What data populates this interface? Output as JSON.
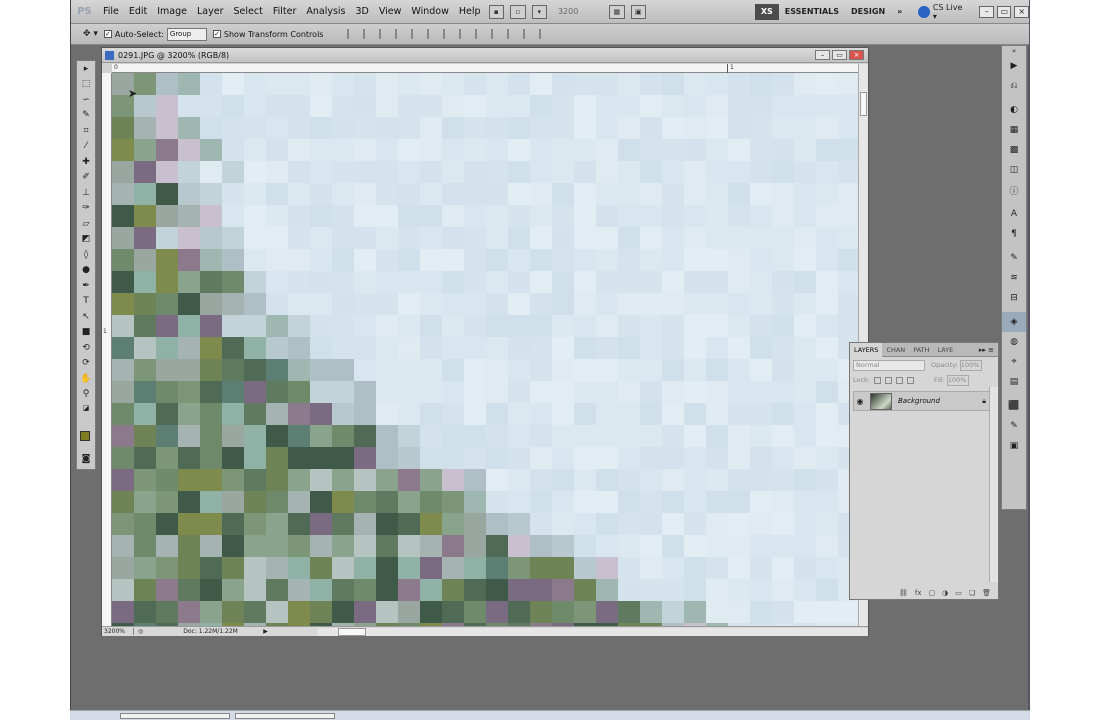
{
  "menubar": {
    "logo": "PS",
    "items": [
      "File",
      "Edit",
      "Image",
      "Layer",
      "Select",
      "Filter",
      "Analysis",
      "3D",
      "View",
      "Window",
      "Help"
    ],
    "zoom_select": "3200",
    "workspace_xs": "XS",
    "workspace_essentials": "ESSENTIALS",
    "workspace_design": "DESIGN",
    "workspace_more": "»",
    "cs_live": "CS Live ▾"
  },
  "optionsbar": {
    "auto_select_label": "Auto-Select:",
    "auto_select_value": "Group",
    "show_transform_label": "Show Transform Controls"
  },
  "document": {
    "title": "0291.JPG @ 3200% (RGB/8)",
    "zoom_percent": "3200%",
    "doc_info": "Doc: 1.22M/1.22M",
    "ruler_h_labels": [
      "0",
      "1"
    ],
    "ruler_v_labels": [
      "1"
    ]
  },
  "layers_panel": {
    "tabs": [
      "LAYERS",
      "CHAN",
      "PATH",
      "LAYE"
    ],
    "blend_mode": "Normal",
    "opacity_label": "Opacity:",
    "opacity_value": "100%",
    "lock_label": "Lock:",
    "fill_label": "Fill:",
    "fill_value": "100%",
    "layer_name": "Background"
  },
  "colors": {
    "foreground": "#7f7d1f",
    "background": "#2651a6"
  }
}
